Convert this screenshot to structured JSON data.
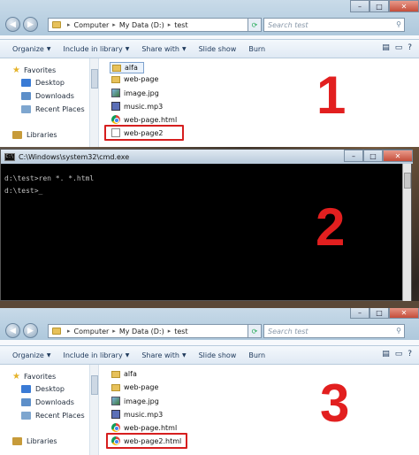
{
  "explorer1": {
    "breadcrumb": [
      "Computer",
      "My Data (D:)",
      "test"
    ],
    "search_placeholder": "Search test",
    "toolbar": [
      "Organize",
      "Include in library",
      "Share with",
      "Slide show",
      "Burn"
    ],
    "nav": {
      "favorites": "Favorites",
      "items": [
        "Desktop",
        "Downloads",
        "Recent Places"
      ],
      "libraries": "Libraries"
    },
    "files": [
      {
        "name": "alfa",
        "type": "folder"
      },
      {
        "name": "web-page",
        "type": "folder"
      },
      {
        "name": "image.jpg",
        "type": "image"
      },
      {
        "name": "music.mp3",
        "type": "audio"
      },
      {
        "name": "web-page.html",
        "type": "chrome"
      },
      {
        "name": "web-page2",
        "type": "blank"
      }
    ],
    "step": "1"
  },
  "cmd": {
    "title": "C:\\Windows\\system32\\cmd.exe",
    "line1": "d:\\test>ren *. *.html",
    "line2": "d:\\test>_",
    "step": "2"
  },
  "explorer3": {
    "breadcrumb": [
      "Computer",
      "My Data (D:)",
      "test"
    ],
    "search_placeholder": "Search test",
    "toolbar": [
      "Organize",
      "Include in library",
      "Share with",
      "Slide show",
      "Burn"
    ],
    "nav": {
      "favorites": "Favorites",
      "items": [
        "Desktop",
        "Downloads",
        "Recent Places"
      ],
      "libraries": "Libraries"
    },
    "files": [
      {
        "name": "alfa",
        "type": "folder"
      },
      {
        "name": "web-page",
        "type": "folder"
      },
      {
        "name": "image.jpg",
        "type": "image"
      },
      {
        "name": "music.mp3",
        "type": "audio"
      },
      {
        "name": "web-page.html",
        "type": "chrome"
      },
      {
        "name": "web-page2.html",
        "type": "chrome"
      }
    ],
    "step": "3"
  },
  "colors": {
    "highlight": "#d61e1e",
    "step_number": "#e21f1f",
    "console_bg": "#000000"
  }
}
